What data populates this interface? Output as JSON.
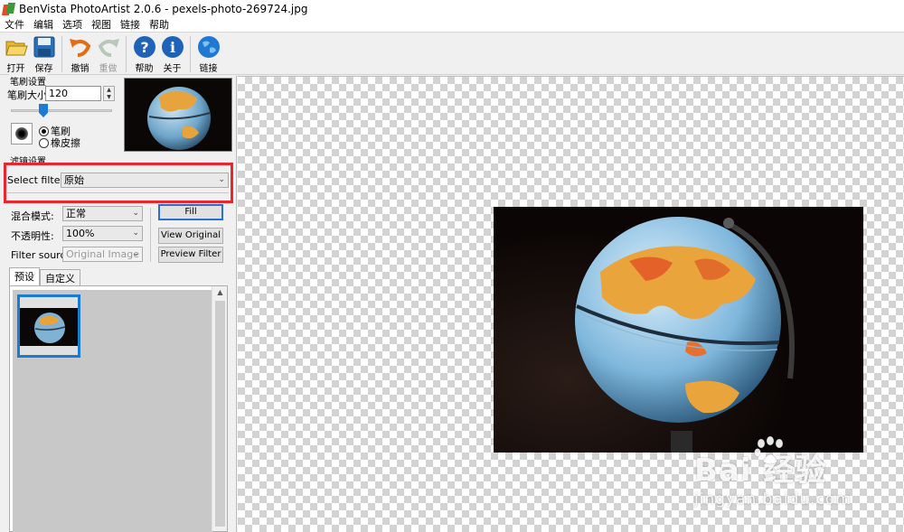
{
  "window": {
    "title": "BenVista PhotoArtist 2.0.6 - pexels-photo-269724.jpg"
  },
  "menu": [
    "文件",
    "编辑",
    "选项",
    "视图",
    "链接",
    "帮助"
  ],
  "toolbar": {
    "open": "打开",
    "save": "保存",
    "undo": "撤销",
    "redo": "重做",
    "help": "帮助",
    "about": "关于",
    "link": "链接"
  },
  "brush": {
    "group_title": "笔刷设置",
    "size_label": "笔刷大小:",
    "size_value": "120",
    "radio_brush": "笔刷",
    "radio_eraser": "橡皮擦"
  },
  "filter": {
    "group_title": "滤镜设置",
    "label": "Select filter:",
    "value": "原始"
  },
  "blend": {
    "label": "混合模式:",
    "value": "正常"
  },
  "opacity": {
    "label": "不透明性:",
    "value": "100%"
  },
  "source": {
    "label": "Filter source:",
    "value": "Original Image"
  },
  "buttons": {
    "fill": "Fill",
    "view_original": "View Original",
    "preview_filter": "Preview Filter"
  },
  "tabs": [
    "预设",
    "自定义"
  ],
  "watermark": {
    "brand": "Bai 经验",
    "url": "jingyan.baidu.com"
  },
  "colors": {
    "highlight": "#e8262e",
    "accent": "#1a7ad4"
  }
}
